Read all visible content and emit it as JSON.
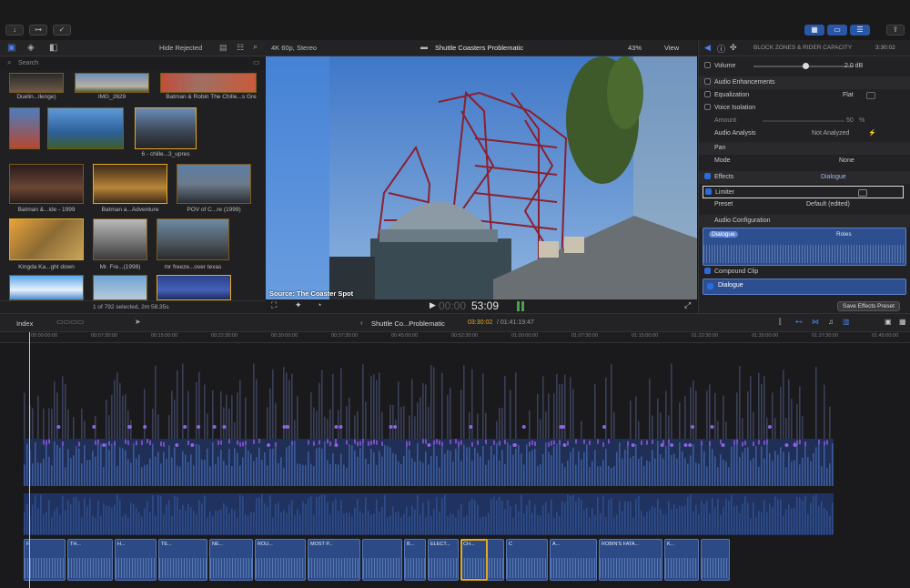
{
  "toolbar": {
    "left_buttons": [
      "↓",
      "⊶",
      "✓"
    ],
    "right_buttons": [
      "▦",
      "▭",
      "☰"
    ],
    "share_icon": "share-icon"
  },
  "browser": {
    "filter": "Hide Rejected",
    "search_placeholder": "Search",
    "thumbnails": [
      {
        "label": "Duelin...llenge)"
      },
      {
        "label": "IMG_2629"
      },
      {
        "label": "Batman & Robin The Chille...s Gre"
      },
      {
        "label": ""
      },
      {
        "label": ""
      },
      {
        "label": "6 - chille...3_upres"
      },
      {
        "label": "Batman &...ide - 1999"
      },
      {
        "label": "Batman a...Adventure"
      },
      {
        "label": "POV of  C...re (1999)"
      },
      {
        "label": "Kingda Ka...ght down"
      },
      {
        "label": "Mr. Fre...(1998)"
      },
      {
        "label": "mr freeze...over texas"
      },
      {
        "label": ""
      },
      {
        "label": ""
      },
      {
        "label": ""
      }
    ],
    "status": "1 of 792 selected, 2m 58.35s"
  },
  "viewer": {
    "format": "4K 60p, Stereo",
    "title": "Shuttle Coasters Problematic",
    "zoom": "43%",
    "view_menu": "View",
    "source_caption": "Source: The Coaster Spot",
    "timecode_dim": "00:00",
    "timecode": "53:09"
  },
  "inspector": {
    "title": "BLOCK ZONES & RIDER CAPACITY",
    "duration": "3:30:02",
    "volume_label": "Volume",
    "volume_value": "2.0 dB",
    "audio_enh": "Audio Enhancements",
    "equalization": "Equalization",
    "eq_value": "Flat",
    "voice_isolation": "Voice Isolation",
    "amount": "Amount",
    "amount_value": "50",
    "amount_unit": "%",
    "audio_analysis": "Audio Analysis",
    "analysis_value": "Not Analyzed",
    "pan": "Pan",
    "mode": "Mode",
    "mode_value": "None",
    "effects": "Effects",
    "effects_value": "Dialogue",
    "limiter": "Limiter",
    "preset": "Preset",
    "preset_value": "Default (edited)",
    "audio_config": "Audio Configuration",
    "roles_tag": "Dialogue",
    "roles_label": "Roles",
    "compound": "Compound Clip",
    "dialogue": "Dialogue",
    "save_preset": "Save Effects Preset"
  },
  "timeline": {
    "index": "Index",
    "project": "Shuttle Co...Problematic",
    "position": "03:30:02",
    "total": "/ 01:41:19:47",
    "ruler": [
      "00:00:00:00",
      "00:07:30:00",
      "00:15:00:00",
      "00:22:30:00",
      "00:30:00:00",
      "00:37:30:00",
      "00:45:00:00",
      "00:52:30:00",
      "01:00:00:00",
      "01:07:30:00",
      "01:15:00:00",
      "01:22:30:00",
      "01:30:00:00",
      "01:37:30:00",
      "01:45:00:00"
    ],
    "clip_labels": [
      "F",
      "TH...",
      "H...",
      "TE...",
      "NE...",
      "ROU...",
      "MOST P...",
      "",
      "B...",
      "ELECT...",
      "CH...",
      "C",
      "A...",
      "ROBIN'S FATA...",
      "K...",
      ""
    ]
  },
  "colors": {
    "accent": "#2c6ae0",
    "selection": "#e3a922",
    "audio_clip": "#2b4a86",
    "purple": "#7b4bc4"
  }
}
